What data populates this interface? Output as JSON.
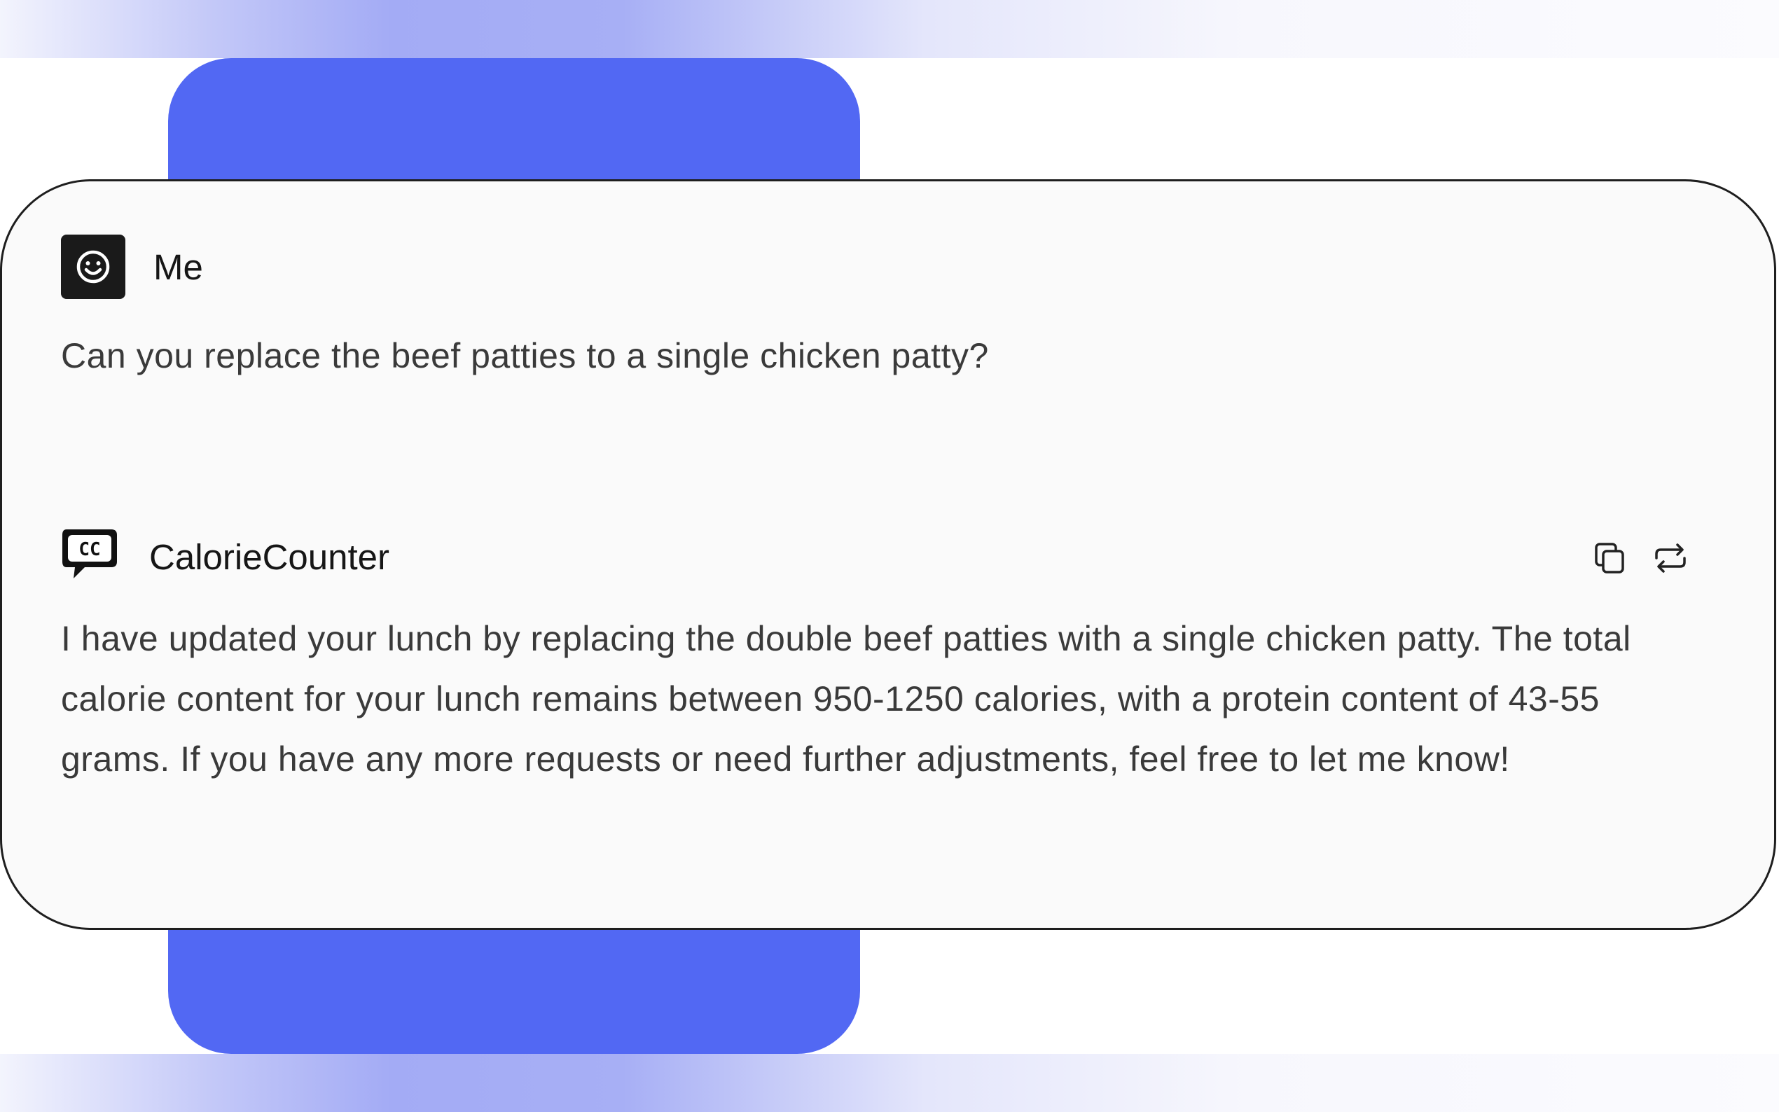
{
  "conversation": {
    "user_message": {
      "sender": "Me",
      "avatar_icon": "smiley-face-icon",
      "text": "Can you replace the beef patties to a single chicken patty?"
    },
    "assistant_message": {
      "sender": "CalorieCounter",
      "avatar_icon": "cc-speech-bubble-logo",
      "logo_text": "CC",
      "text": "I have updated your lunch by replacing the double beef patties with a single chicken patty. The total calorie content for your lunch remains between 950-1250 calories, with a protein content of 43-55 grams. If you have any more requests or need further adjustments, feel free to let me know!",
      "actions": [
        {
          "icon": "copy-icon"
        },
        {
          "icon": "regenerate-icon"
        }
      ]
    }
  },
  "colors": {
    "accent_blue": "#5268f3",
    "card_background": "#fafafa",
    "card_border": "#1e1e1e",
    "text_dark": "#161616",
    "text_body": "#3a3a3a"
  }
}
